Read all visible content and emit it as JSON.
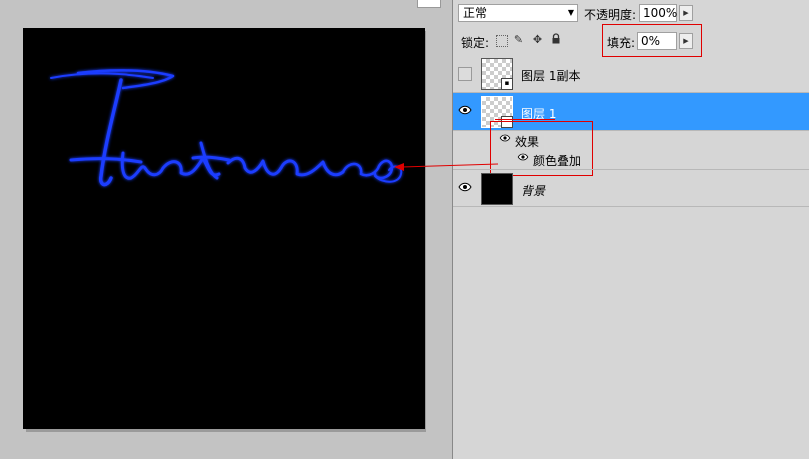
{
  "canvas": {
    "signature_text": "Thatma"
  },
  "layers_panel": {
    "blend_mode": "正常",
    "opacity_label": "不透明度:",
    "opacity_value": "100%",
    "lock_label": "锁定:",
    "fill_label": "填充:",
    "fill_value": "0%",
    "layers": [
      {
        "name": "图层 1副本",
        "visible": false,
        "type": "smart-object"
      },
      {
        "name": "图层 1",
        "visible": true,
        "selected": true,
        "type": "smart-object"
      },
      {
        "name": "背景",
        "visible": true,
        "type": "background"
      }
    ],
    "effects": {
      "group_label": "效果",
      "items": [
        "颜色叠加"
      ]
    }
  },
  "colors": {
    "selection": "#3399ff",
    "annotation": "#e00000",
    "stroke": "#1a3cff"
  }
}
